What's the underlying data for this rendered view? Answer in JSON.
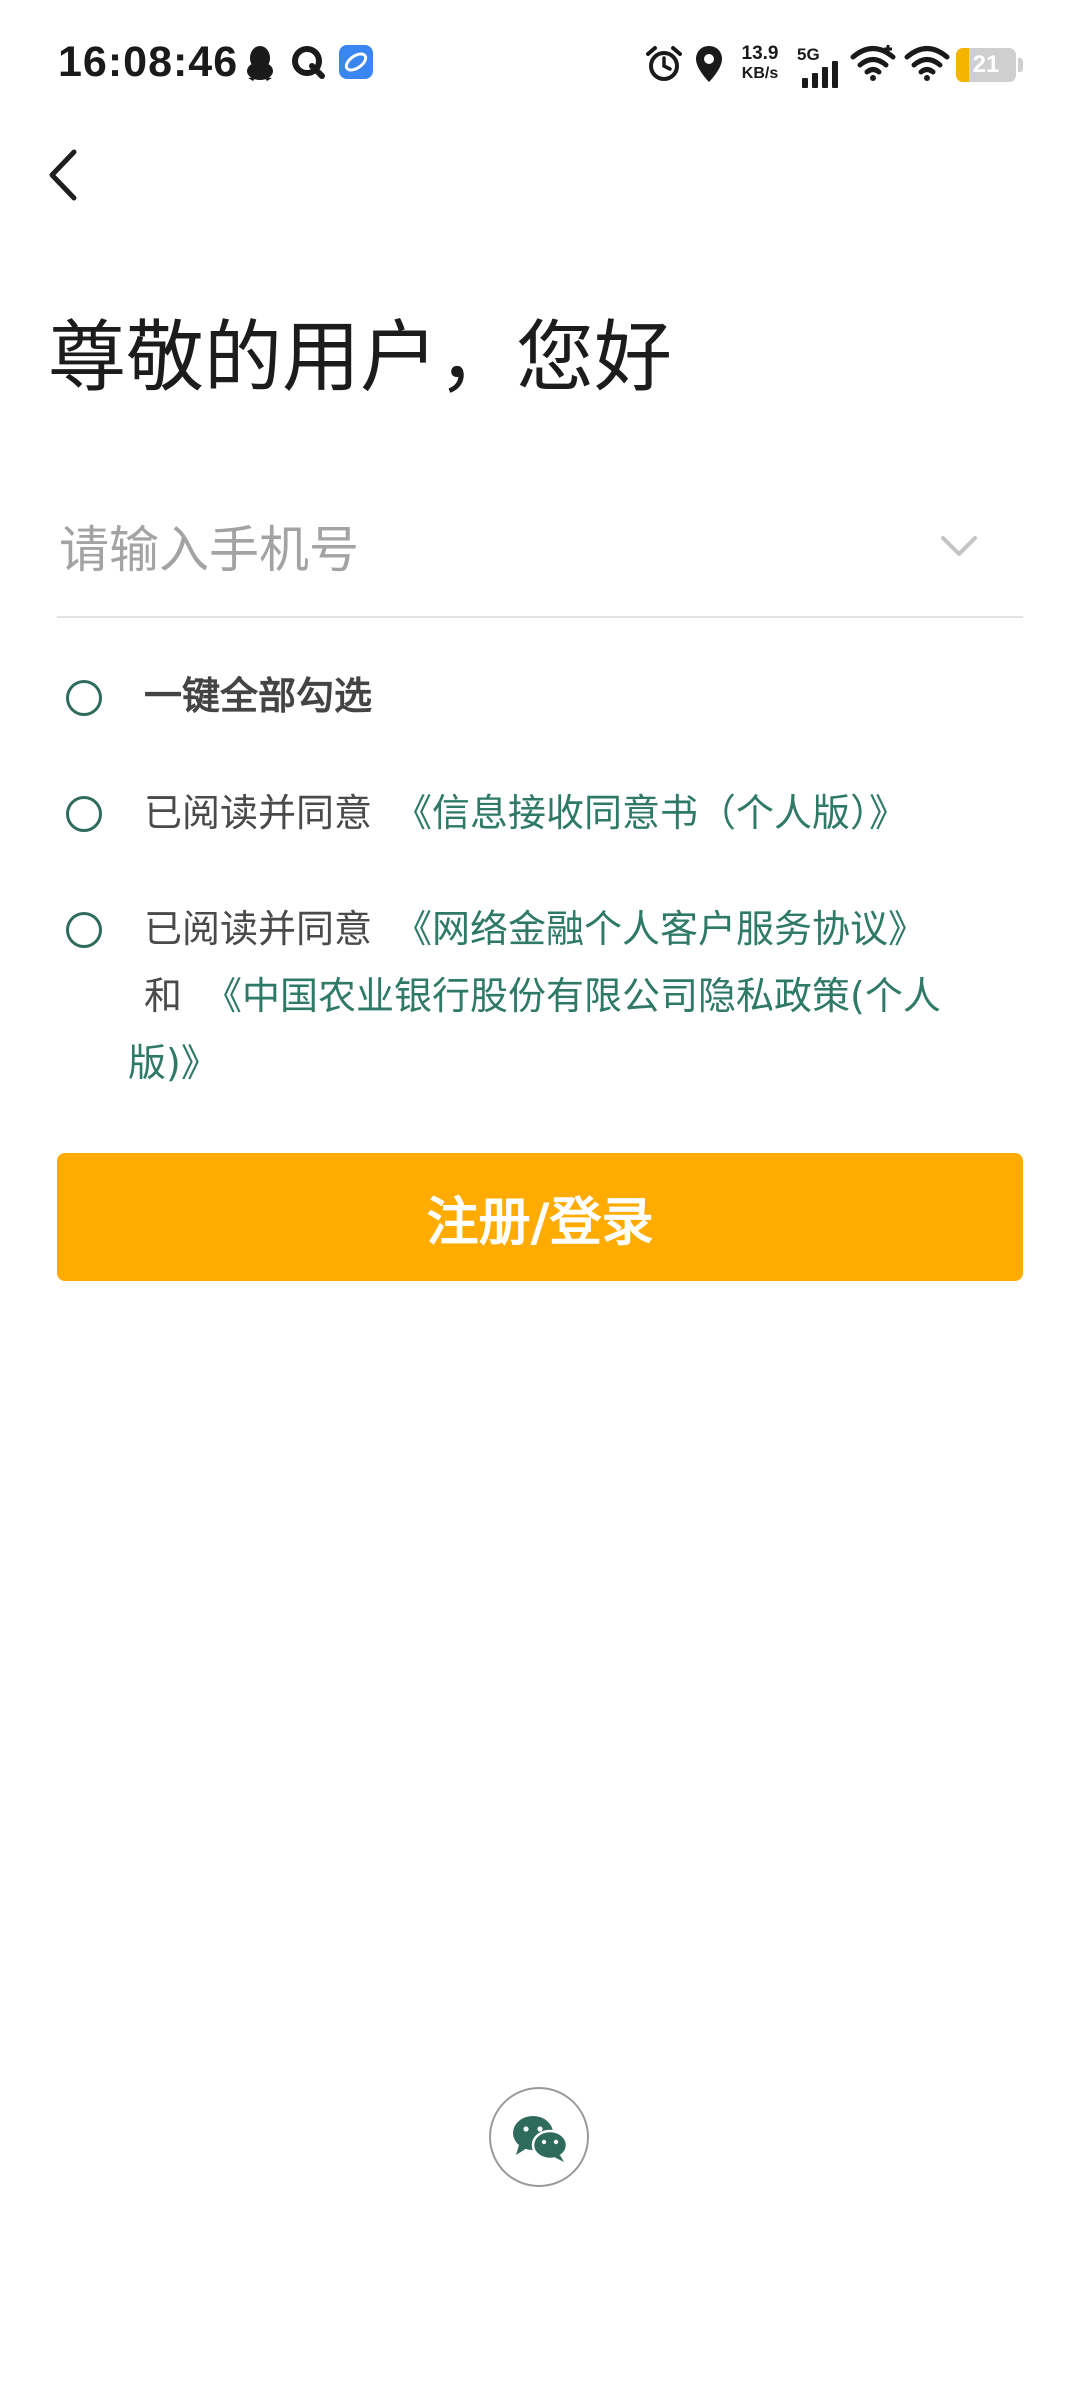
{
  "status_bar": {
    "time": "16:08:46",
    "net_speed_value": "13.9",
    "net_speed_unit": "KB/s",
    "network_type": "5G",
    "battery_level": "21",
    "battery_fraction": 0.21,
    "icons": [
      "qq-icon",
      "search-app-icon",
      "app-icon",
      "alarm-icon",
      "location-icon",
      "signal-icon",
      "wifi-icon",
      "wifi-icon",
      "battery-icon"
    ]
  },
  "header": {
    "back_icon": "chevron-left-icon"
  },
  "main": {
    "greeting": "尊敬的用户，您好",
    "phone_placeholder": "请输入手机号",
    "phone_value": "",
    "dropdown_icon": "chevron-down-icon"
  },
  "agreements": {
    "select_all": "一键全部勾选",
    "item1": {
      "prefix": "已阅读并同意",
      "link1": "《信息接收同意书（个人版）》"
    },
    "item2": {
      "prefix": "已阅读并同意",
      "link1": "《网络金融个人客户服务协议》",
      "conjunction": "和",
      "link2_line1": "《中国农业银行股份有限公司隐私政策(个人",
      "link2_line2": "版)》"
    }
  },
  "actions": {
    "submit_label": "注册/登录",
    "wechat_icon": "wechat-icon"
  },
  "colors": {
    "accent": "#ffab00",
    "link": "#2f7a67",
    "radio": "#2f6b5c",
    "battery": "#f5b400"
  }
}
